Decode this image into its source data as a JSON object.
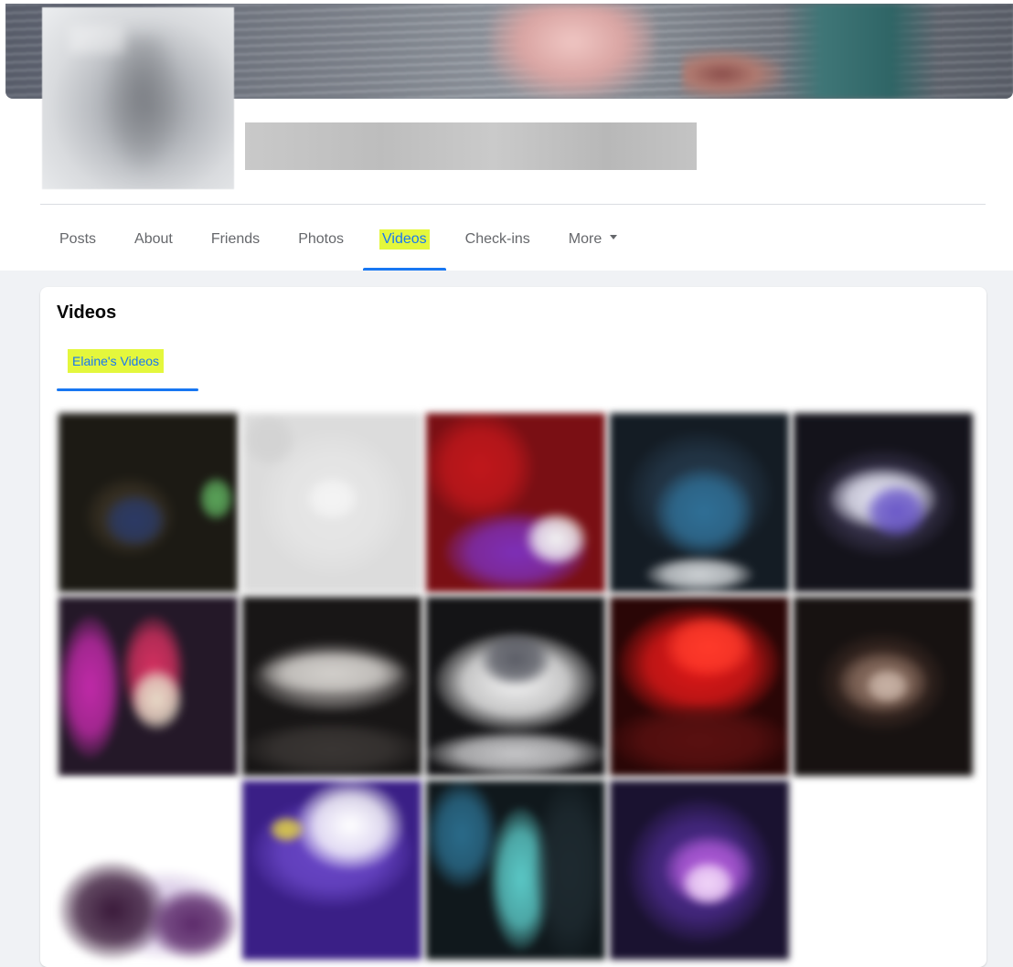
{
  "profile": {
    "tabs": [
      {
        "label": "Posts"
      },
      {
        "label": "About"
      },
      {
        "label": "Friends"
      },
      {
        "label": "Photos"
      },
      {
        "label": "Videos",
        "active": true
      },
      {
        "label": "Check-ins"
      },
      {
        "label": "More",
        "has_dropdown": true
      }
    ]
  },
  "videos_section": {
    "title": "Videos",
    "subtab_label": "Elaine's Videos",
    "thumbnails": [
      {
        "row": 1,
        "col": 1,
        "palette": [
          "#1c1a14",
          "#3a3224",
          "#2b3a66",
          "#5ba65a"
        ]
      },
      {
        "row": 1,
        "col": 2,
        "palette": [
          "#dcdcdc",
          "#e6e6e6",
          "#f4f4f4",
          "#d2d2d2"
        ]
      },
      {
        "row": 1,
        "col": 3,
        "palette": [
          "#7a0f14",
          "#c0171b",
          "#7d2fb8",
          "#f2f2f2"
        ]
      },
      {
        "row": 1,
        "col": 4,
        "palette": [
          "#141c24",
          "#24384a",
          "#2f6f96",
          "#cfd3d6"
        ]
      },
      {
        "row": 1,
        "col": 5,
        "palette": [
          "#14131b",
          "#3a3550",
          "#e9e9f7",
          "#6a58c8"
        ]
      },
      {
        "row": 2,
        "col": 1,
        "palette": [
          "#241828",
          "#c02aa8",
          "#d43060",
          "#e6d9c6"
        ]
      },
      {
        "row": 2,
        "col": 2,
        "palette": [
          "#181616",
          "#8a8684",
          "#d2cfcb",
          "#3a3634"
        ]
      },
      {
        "row": 2,
        "col": 3,
        "palette": [
          "#141416",
          "#f2f2f2",
          "#c7c7c9",
          "#5b5d66"
        ]
      },
      {
        "row": 2,
        "col": 4,
        "palette": [
          "#2a0606",
          "#e01818",
          "#ff3a2a",
          "#5a1010"
        ]
      },
      {
        "row": 2,
        "col": 5,
        "palette": [
          "#171211",
          "#3e2b24",
          "#8a6e60",
          "#c9b3a6"
        ]
      },
      {
        "row": 3,
        "col": 1,
        "palette": [
          "#ffffff",
          "#d6c7e4",
          "#3a1a3a",
          "#5c2a6a"
        ]
      },
      {
        "row": 3,
        "col": 2,
        "palette": [
          "#3a1f86",
          "#6a47c8",
          "#ffffff",
          "#d9c84a"
        ]
      },
      {
        "row": 3,
        "col": 3,
        "palette": [
          "#10181c",
          "#2a6b8a",
          "#5ac8c6",
          "#1e2a30"
        ]
      },
      {
        "row": 3,
        "col": 4,
        "palette": [
          "#1a1230",
          "#4a2a8a",
          "#b05ad8",
          "#f1d6f8"
        ]
      }
    ]
  },
  "colors": {
    "accent": "#1877f2",
    "highlight": "#e4f73c",
    "tab_text": "#65676b",
    "page_background": "#f0f2f5"
  }
}
